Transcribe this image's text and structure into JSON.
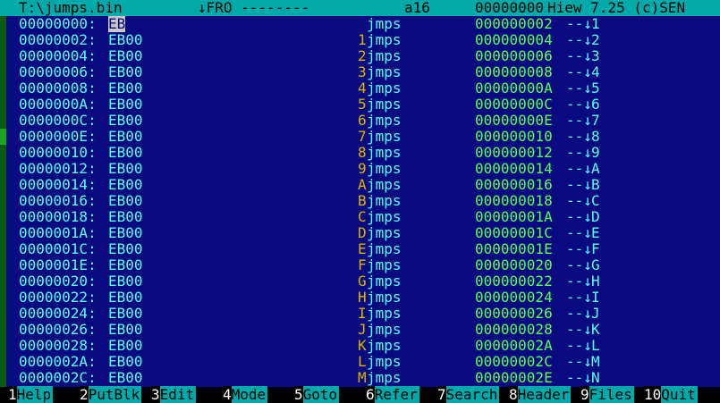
{
  "header": {
    "filename": "T:\\jumps.bin",
    "mode": "↓FRO --------",
    "bits": "a16",
    "offset": "00000000",
    "app": "Hiew 7.25 (c)SEN"
  },
  "rows": [
    {
      "addr": "00000000:",
      "bytes": "EB00",
      "mark": "",
      "mnem": "jmps",
      "target": "000000002",
      "arrow": "--↓",
      "label": "1"
    },
    {
      "addr": "00000002:",
      "bytes": "EB00",
      "mark": "1",
      "mnem": "jmps",
      "target": "000000004",
      "arrow": "--↓",
      "label": "2"
    },
    {
      "addr": "00000004:",
      "bytes": "EB00",
      "mark": "2",
      "mnem": "jmps",
      "target": "000000006",
      "arrow": "--↓",
      "label": "3"
    },
    {
      "addr": "00000006:",
      "bytes": "EB00",
      "mark": "3",
      "mnem": "jmps",
      "target": "000000008",
      "arrow": "--↓",
      "label": "4"
    },
    {
      "addr": "00000008:",
      "bytes": "EB00",
      "mark": "4",
      "mnem": "jmps",
      "target": "00000000A",
      "arrow": "--↓",
      "label": "5"
    },
    {
      "addr": "0000000A:",
      "bytes": "EB00",
      "mark": "5",
      "mnem": "jmps",
      "target": "00000000C",
      "arrow": "--↓",
      "label": "6"
    },
    {
      "addr": "0000000C:",
      "bytes": "EB00",
      "mark": "6",
      "mnem": "jmps",
      "target": "00000000E",
      "arrow": "--↓",
      "label": "7"
    },
    {
      "addr": "0000000E:",
      "bytes": "EB00",
      "mark": "7",
      "mnem": "jmps",
      "target": "000000010",
      "arrow": "--↓",
      "label": "8"
    },
    {
      "addr": "00000010:",
      "bytes": "EB00",
      "mark": "8",
      "mnem": "jmps",
      "target": "000000012",
      "arrow": "--↓",
      "label": "9"
    },
    {
      "addr": "00000012:",
      "bytes": "EB00",
      "mark": "9",
      "mnem": "jmps",
      "target": "000000014",
      "arrow": "--↓",
      "label": "A"
    },
    {
      "addr": "00000014:",
      "bytes": "EB00",
      "mark": "A",
      "mnem": "jmps",
      "target": "000000016",
      "arrow": "--↓",
      "label": "B"
    },
    {
      "addr": "00000016:",
      "bytes": "EB00",
      "mark": "B",
      "mnem": "jmps",
      "target": "000000018",
      "arrow": "--↓",
      "label": "C"
    },
    {
      "addr": "00000018:",
      "bytes": "EB00",
      "mark": "C",
      "mnem": "jmps",
      "target": "00000001A",
      "arrow": "--↓",
      "label": "D"
    },
    {
      "addr": "0000001A:",
      "bytes": "EB00",
      "mark": "D",
      "mnem": "jmps",
      "target": "00000001C",
      "arrow": "--↓",
      "label": "E"
    },
    {
      "addr": "0000001C:",
      "bytes": "EB00",
      "mark": "E",
      "mnem": "jmps",
      "target": "00000001E",
      "arrow": "--↓",
      "label": "F"
    },
    {
      "addr": "0000001E:",
      "bytes": "EB00",
      "mark": "F",
      "mnem": "jmps",
      "target": "000000020",
      "arrow": "--↓",
      "label": "G"
    },
    {
      "addr": "00000020:",
      "bytes": "EB00",
      "mark": "G",
      "mnem": "jmps",
      "target": "000000022",
      "arrow": "--↓",
      "label": "H"
    },
    {
      "addr": "00000022:",
      "bytes": "EB00",
      "mark": "H",
      "mnem": "jmps",
      "target": "000000024",
      "arrow": "--↓",
      "label": "I"
    },
    {
      "addr": "00000024:",
      "bytes": "EB00",
      "mark": "I",
      "mnem": "jmps",
      "target": "000000026",
      "arrow": "--↓",
      "label": "J"
    },
    {
      "addr": "00000026:",
      "bytes": "EB00",
      "mark": "J",
      "mnem": "jmps",
      "target": "000000028",
      "arrow": "--↓",
      "label": "K"
    },
    {
      "addr": "00000028:",
      "bytes": "EB00",
      "mark": "K",
      "mnem": "jmps",
      "target": "00000002A",
      "arrow": "--↓",
      "label": "L"
    },
    {
      "addr": "0000002A:",
      "bytes": "EB00",
      "mark": "L",
      "mnem": "jmps",
      "target": "00000002C",
      "arrow": "--↓",
      "label": "M"
    },
    {
      "addr": "0000002C:",
      "bytes": "EB00",
      "mark": "M",
      "mnem": "jmps",
      "target": "00000002E",
      "arrow": "--↓",
      "label": "N"
    }
  ],
  "fkeys": [
    {
      "num": "1",
      "label": "Help"
    },
    {
      "num": "2",
      "label": "PutBlk"
    },
    {
      "num": "3",
      "label": "Edit"
    },
    {
      "num": "4",
      "label": "Mode"
    },
    {
      "num": "5",
      "label": "Goto"
    },
    {
      "num": "6",
      "label": "Refer"
    },
    {
      "num": "7",
      "label": "Search"
    },
    {
      "num": "8",
      "label": "Header"
    },
    {
      "num": "9",
      "label": "Files"
    },
    {
      "num": "10",
      "label": "Quit"
    }
  ]
}
